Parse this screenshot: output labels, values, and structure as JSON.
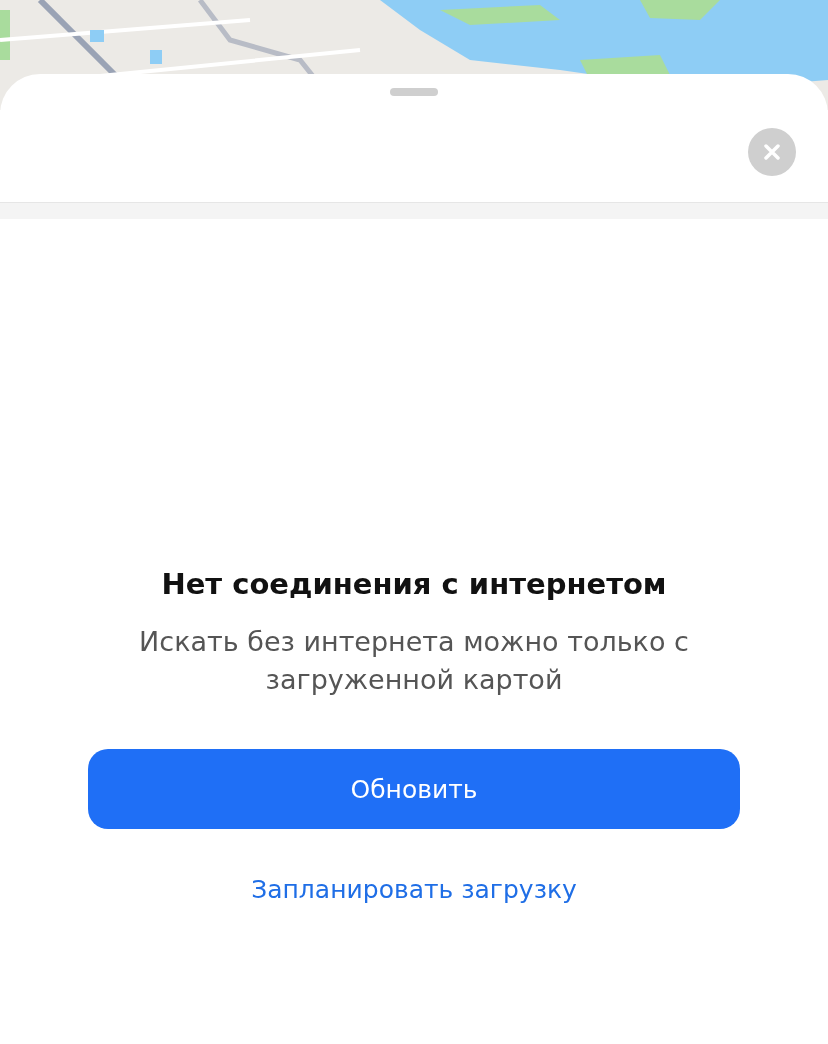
{
  "sheet": {
    "title": "Нет соединения с интернетом",
    "message": "Искать без интернета можно только с загруженной картой",
    "primary_button": "Обновить",
    "secondary_link": "Запланировать загрузку"
  }
}
